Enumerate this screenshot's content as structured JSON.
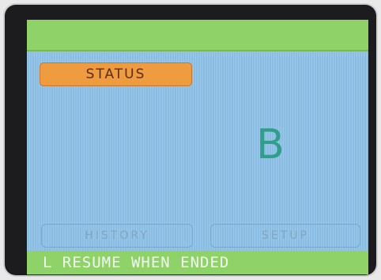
{
  "screen": {
    "colors": {
      "bar_green": "#8ed268",
      "background_blue": "#8fc3e9",
      "status_orange": "#ef9b3f",
      "letter_teal": "#2f9f8a"
    }
  },
  "status_button": {
    "label": "STATUS"
  },
  "main": {
    "letter": "B"
  },
  "buttons": {
    "history": "HISTORY",
    "setup": "SETUP"
  },
  "bottom_bar": {
    "message": "L RESUME WHEN ENDED"
  }
}
